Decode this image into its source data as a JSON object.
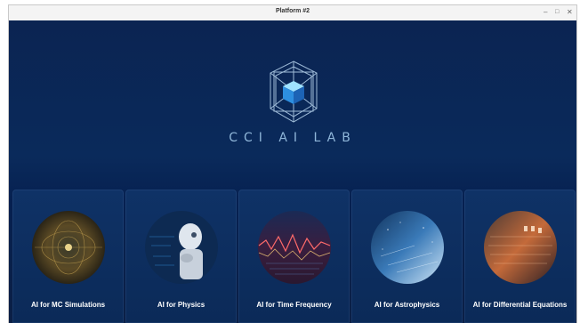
{
  "window": {
    "title": "Platform #2"
  },
  "lab": {
    "title": "CCI AI LAB"
  },
  "cards": [
    {
      "label": "AI for MC Simulations"
    },
    {
      "label": "AI for Physics"
    },
    {
      "label": "AI for Time Frequency"
    },
    {
      "label": "AI for Astrophysics"
    },
    {
      "label": "AI for Differential Equations"
    }
  ],
  "colors": {
    "background": "#0a2147",
    "accent": "#3da9ff",
    "card": "#0f3266"
  }
}
